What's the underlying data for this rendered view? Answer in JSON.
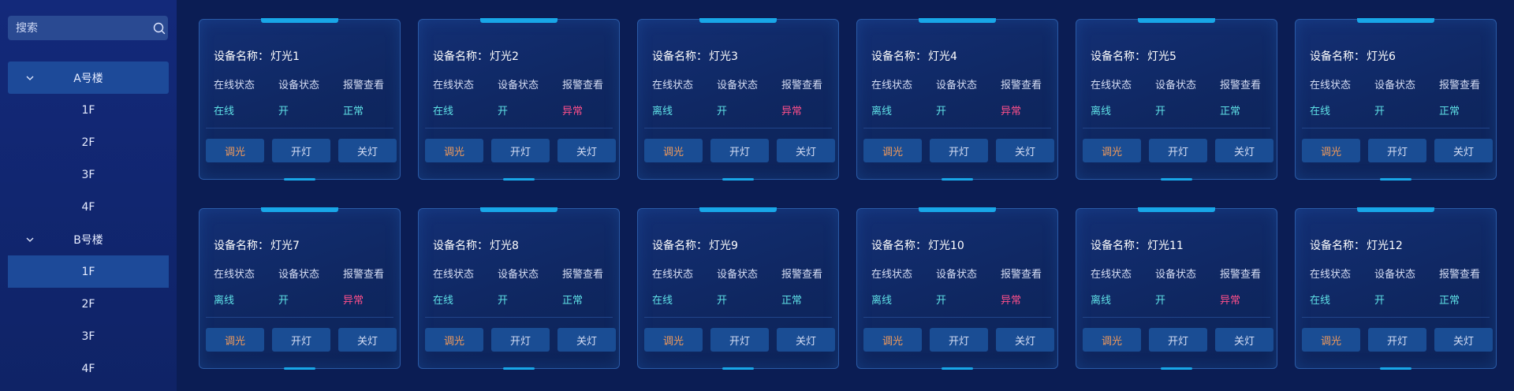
{
  "search": {
    "placeholder": "搜索"
  },
  "tree": {
    "buildings": [
      {
        "label": "A号楼",
        "floors": [
          "1F",
          "2F",
          "3F",
          "4F"
        ]
      },
      {
        "label": "B号楼",
        "floors": [
          "1F",
          "2F",
          "3F",
          "4F"
        ]
      }
    ]
  },
  "labels": {
    "name_prefix": "设备名称：",
    "online_status": "在线状态",
    "device_status": "设备状态",
    "alarm_view": "报警查看",
    "dim": "调光",
    "turn_on": "开灯",
    "turn_off": "关灯"
  },
  "devices": [
    {
      "name": "灯光1",
      "online": "在线",
      "device": "开",
      "alarm": "正常"
    },
    {
      "name": "灯光2",
      "online": "在线",
      "device": "开",
      "alarm": "异常"
    },
    {
      "name": "灯光3",
      "online": "离线",
      "device": "开",
      "alarm": "异常"
    },
    {
      "name": "灯光4",
      "online": "离线",
      "device": "开",
      "alarm": "异常"
    },
    {
      "name": "灯光5",
      "online": "离线",
      "device": "开",
      "alarm": "正常"
    },
    {
      "name": "灯光6",
      "online": "在线",
      "device": "开",
      "alarm": "正常"
    },
    {
      "name": "灯光7",
      "online": "离线",
      "device": "开",
      "alarm": "异常"
    },
    {
      "name": "灯光8",
      "online": "在线",
      "device": "开",
      "alarm": "正常"
    },
    {
      "name": "灯光9",
      "online": "在线",
      "device": "开",
      "alarm": "正常"
    },
    {
      "name": "灯光10",
      "online": "离线",
      "device": "开",
      "alarm": "异常"
    },
    {
      "name": "灯光11",
      "online": "离线",
      "device": "开",
      "alarm": "异常"
    },
    {
      "name": "灯光12",
      "online": "在线",
      "device": "开",
      "alarm": "正常"
    }
  ],
  "colors": {
    "accent": "#18a7e8",
    "status_ok": "#5fe1e6",
    "status_alarm": "#ff4f8a",
    "dim_button": "#f29a5a"
  },
  "icons": {
    "search": "search-icon",
    "expand": "chevron-down-icon"
  }
}
